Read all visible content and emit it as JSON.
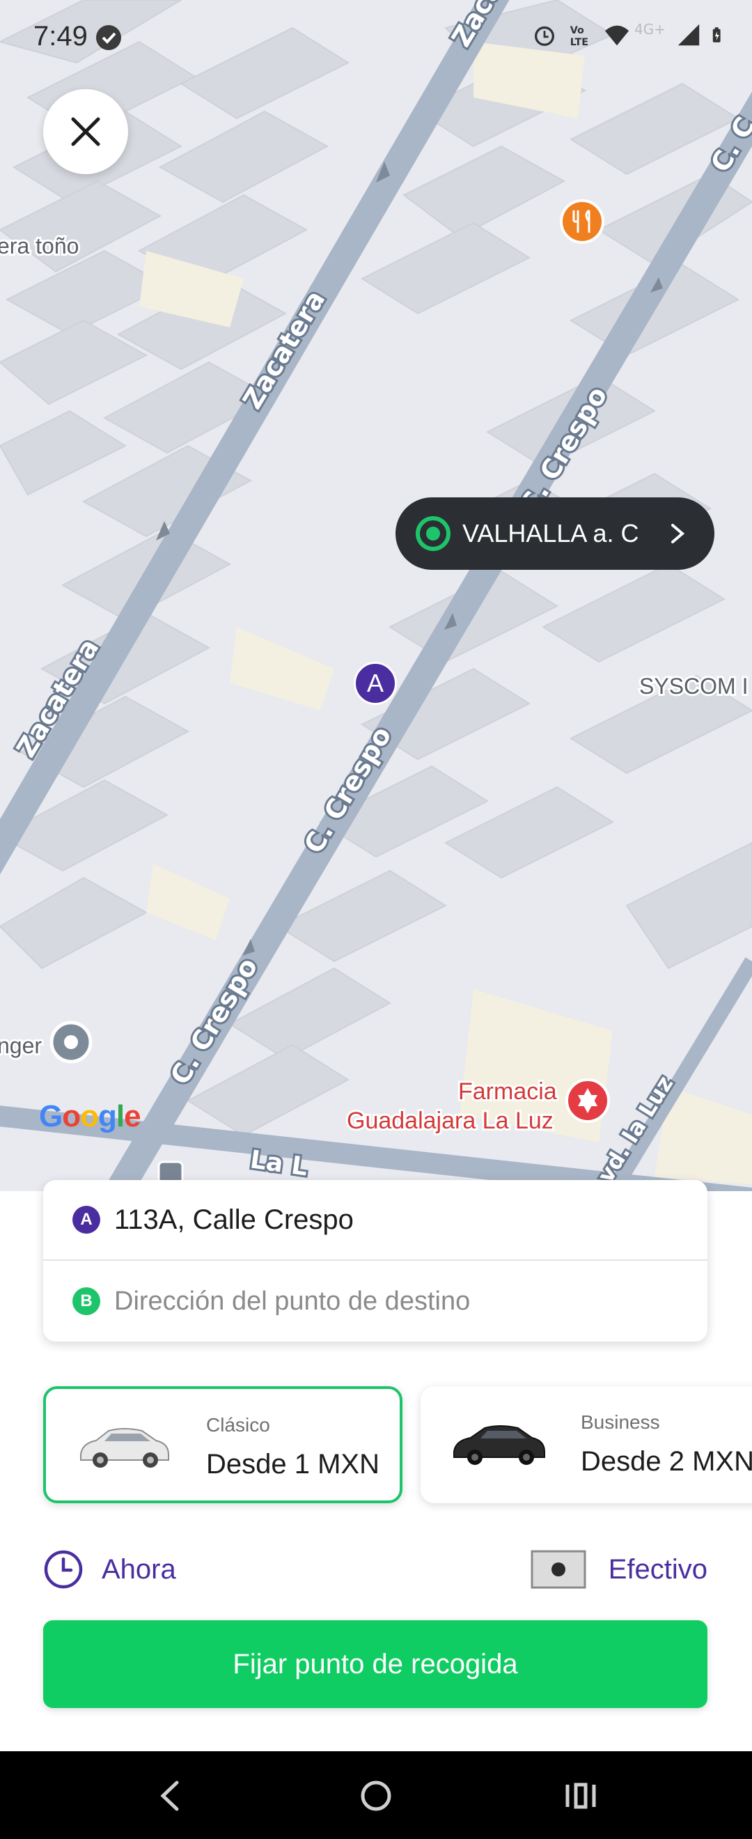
{
  "status_bar": {
    "time": "7:49",
    "network_label": "4G+"
  },
  "map": {
    "streets": {
      "zacatera": "Zacatera",
      "crespo": "C. Crespo",
      "c_partial": "C. C",
      "la_luz_partial": "La L",
      "blvd_partial": "vd. la Luz"
    },
    "poi_labels": {
      "top_left": "era toño",
      "syscom": "SYSCOM I",
      "left_bottom": "nger",
      "farmacia_line1": "Farmacia",
      "farmacia_line2": "Guadalajara La Luz"
    },
    "chip_label": "VALHALLA a. C",
    "pin_a_letter": "A",
    "logo": [
      "G",
      "o",
      "o",
      "g",
      "l",
      "e"
    ],
    "logo_colors": [
      "#4285F4",
      "#EA4335",
      "#FBBC05",
      "#4285F4",
      "#34A853",
      "#EA4335"
    ]
  },
  "address": {
    "origin_letter": "A",
    "origin": "113A, Calle Crespo",
    "destination_letter": "B",
    "destination_placeholder": "Dirección del punto de destino"
  },
  "rides": [
    {
      "name": "Clásico",
      "price": "Desde 1 MXN",
      "selected": true,
      "car_color": "#e9e9ea"
    },
    {
      "name": "Business",
      "price": "Desde 2 MXN",
      "selected": false,
      "car_color": "#2a2a2a"
    }
  ],
  "options": {
    "time": "Ahora",
    "payment": "Efectivo"
  },
  "confirm_button": "Fijar punto de recogida",
  "colors": {
    "accent_green": "#0fcd62",
    "accent_purple": "#4a2ea0"
  }
}
